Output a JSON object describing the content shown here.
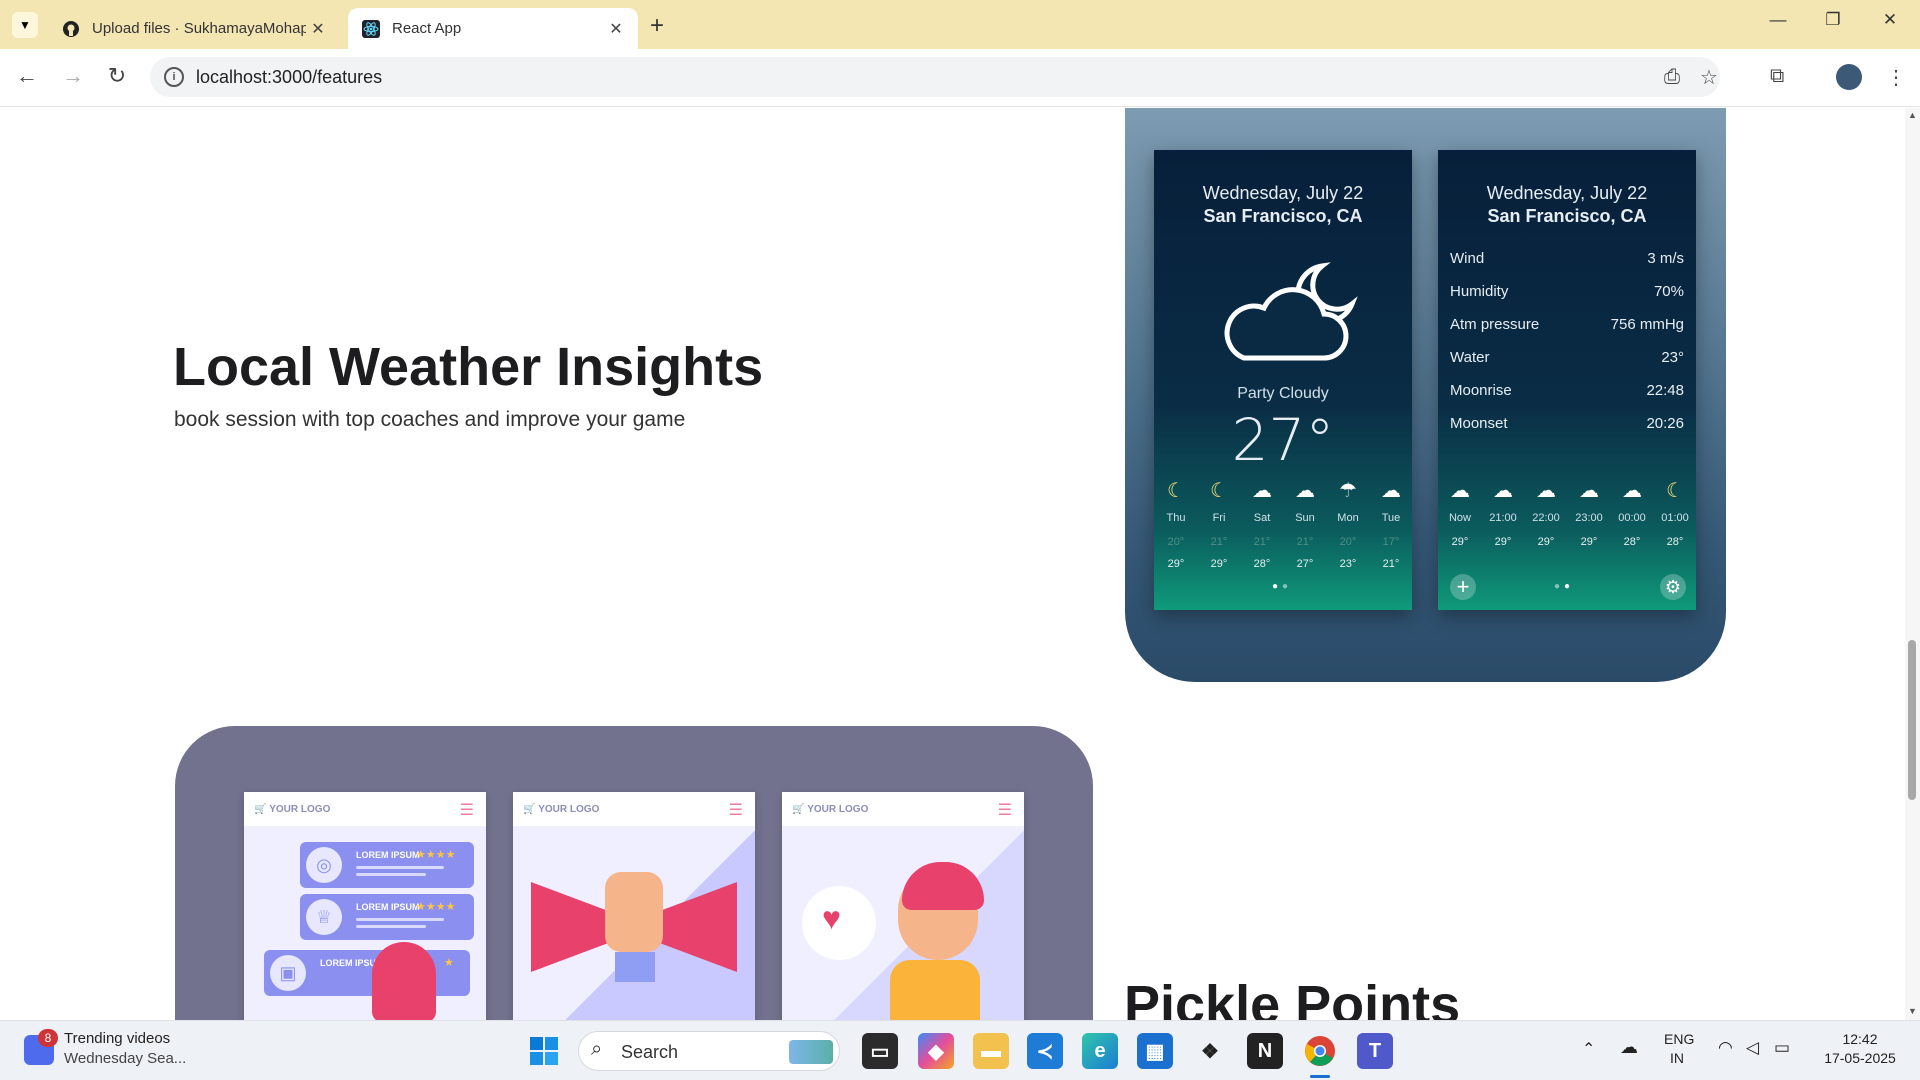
{
  "browser": {
    "tabs": [
      {
        "title": "Upload files · SukhamayaMohap",
        "icon": "github-icon",
        "active": false
      },
      {
        "title": "React App",
        "icon": "react-icon",
        "active": true
      }
    ],
    "url": "localhost:3000/features"
  },
  "page": {
    "weather_section": {
      "title": "Local Weather Insights",
      "subtitle": "book session with top coaches and improve your game"
    },
    "phone1": {
      "date": "Wednesday, July 22",
      "city": "San Francisco, CA",
      "condition": "Party Cloudy",
      "temperature": "27°",
      "forecast": [
        {
          "day": "Thu",
          "icon": "moon-icon",
          "low": "20°",
          "high": "29°"
        },
        {
          "day": "Fri",
          "icon": "moon-icon",
          "low": "21°",
          "high": "29°"
        },
        {
          "day": "Sat",
          "icon": "cloud-moon-icon",
          "low": "21°",
          "high": "28°"
        },
        {
          "day": "Sun",
          "icon": "cloud-icon",
          "low": "21°",
          "high": "27°"
        },
        {
          "day": "Mon",
          "icon": "rain-icon",
          "low": "20°",
          "high": "23°"
        },
        {
          "day": "Tue",
          "icon": "storm-icon",
          "low": "17°",
          "high": "21°"
        }
      ]
    },
    "phone2": {
      "date": "Wednesday, July 22",
      "city": "San Francisco, CA",
      "details": [
        {
          "label": "Wind",
          "value": "3 m/s"
        },
        {
          "label": "Humidity",
          "value": "70%"
        },
        {
          "label": "Atm  pressure",
          "value": "756 mmHg"
        },
        {
          "label": "Water",
          "value": "23°"
        },
        {
          "label": "Moonrise",
          "value": "22:48"
        },
        {
          "label": "Moonset",
          "value": "20:26"
        }
      ],
      "hourly": [
        {
          "time": "Now",
          "icon": "cloud-moon-icon",
          "temp": "29°"
        },
        {
          "time": "21:00",
          "icon": "cloud-moon-icon",
          "temp": "29°"
        },
        {
          "time": "22:00",
          "icon": "cloud-moon-icon",
          "temp": "29°"
        },
        {
          "time": "23:00",
          "icon": "cloud-moon-icon",
          "temp": "29°"
        },
        {
          "time": "00:00",
          "icon": "cloud-moon-icon",
          "temp": "28°"
        },
        {
          "time": "01:00",
          "icon": "moon-icon",
          "temp": "28°"
        }
      ]
    },
    "shop_card": {
      "logo_text": "YOUR LOGO",
      "list_label": "LOREM IPSUM"
    },
    "pickle_section": {
      "title": "Pickle Points"
    }
  },
  "taskbar": {
    "news_badge": "8",
    "news_title": "Trending videos",
    "news_sub": "Wednesday Sea...",
    "search_label": "Search",
    "lang_top": "ENG",
    "lang_bottom": "IN",
    "time": "12:42",
    "date": "17-05-2025"
  },
  "colors": {
    "tab_bar": "#f4e6b3",
    "weather_card": "#5e7f98",
    "shop_card": "#72728f",
    "accent_green": "#0f9a7a"
  }
}
